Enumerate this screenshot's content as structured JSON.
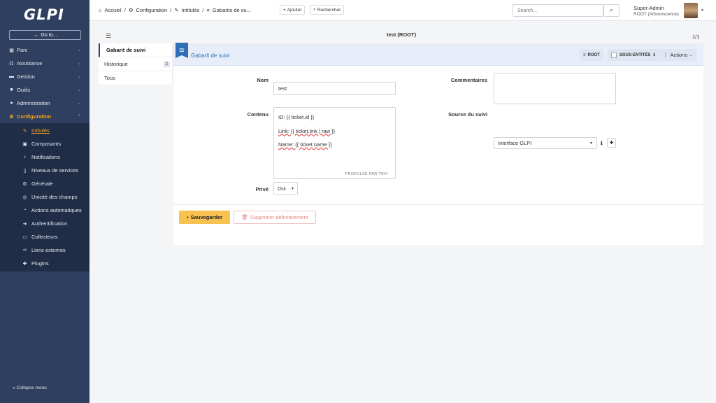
{
  "app": {
    "logo": "GLPI",
    "goto_label": "Go to..."
  },
  "sidebar": {
    "items": [
      {
        "label": "Parc",
        "icon": "boxes-icon"
      },
      {
        "label": "Assistance",
        "icon": "headset-icon"
      },
      {
        "label": "Gestion",
        "icon": "wallet-icon"
      },
      {
        "label": "Outils",
        "icon": "briefcase-icon"
      },
      {
        "label": "Administration",
        "icon": "users-cog-icon"
      },
      {
        "label": "Configuration",
        "icon": "cog-icon"
      }
    ],
    "submenu": [
      {
        "label": "Intitulés",
        "icon": "edit-icon"
      },
      {
        "label": "Composants",
        "icon": "components-icon"
      },
      {
        "label": "Notifications",
        "icon": "bell-icon"
      },
      {
        "label": "Niveaux de services",
        "icon": "file-icon"
      },
      {
        "label": "Générale",
        "icon": "cog-icon"
      },
      {
        "label": "Unicité des champs",
        "icon": "fingerprint-icon"
      },
      {
        "label": "Actions automatiques",
        "icon": "stopwatch-icon"
      },
      {
        "label": "Authentification",
        "icon": "sign-in-icon"
      },
      {
        "label": "Collecteurs",
        "icon": "inbox-icon"
      },
      {
        "label": "Liens externes",
        "icon": "link-icon"
      },
      {
        "label": "Plugins",
        "icon": "puzzle-icon"
      }
    ],
    "collapse_label": "Collapse menu"
  },
  "header": {
    "breadcrumb": [
      "Accueil",
      "Configuration",
      "Intitulés",
      "Gabarits de su..."
    ],
    "add_label": "Ajouter",
    "search_label": "Rechercher",
    "search_placeholder": "Search...",
    "user_name": "Super-Admin",
    "user_entity": "ROOT (Arborescence)"
  },
  "page": {
    "title": "test (ROOT)",
    "pager": "1/1"
  },
  "tabs": [
    {
      "label": "Gabarit de suivi",
      "count": ""
    },
    {
      "label": "Historique",
      "count": "2"
    },
    {
      "label": "Tous",
      "count": ""
    }
  ],
  "panel": {
    "title": "Gabarit de suivi",
    "root_label": "ROOT",
    "subentities_label": "SOUS-ENTITÉS",
    "actions_label": "Actions"
  },
  "form": {
    "nom_label": "Nom",
    "nom_value": "test",
    "commentaires_label": "Commentaires",
    "contenu_label": "Contenu",
    "content_lines": [
      "ID: {{ ticket.id }}",
      "Link: {{ ticket.link | raw }}",
      "Name: {{ ticket.name }}"
    ],
    "powered_by": "PROPULSÉ PAR TINY",
    "source_label": "Source du suivi",
    "source_value": "Interface GLPI",
    "prive_label": "Privé",
    "prive_value": "Oui",
    "save_label": "Sauvegarder",
    "delete_label": "Supprimer définitivement"
  }
}
